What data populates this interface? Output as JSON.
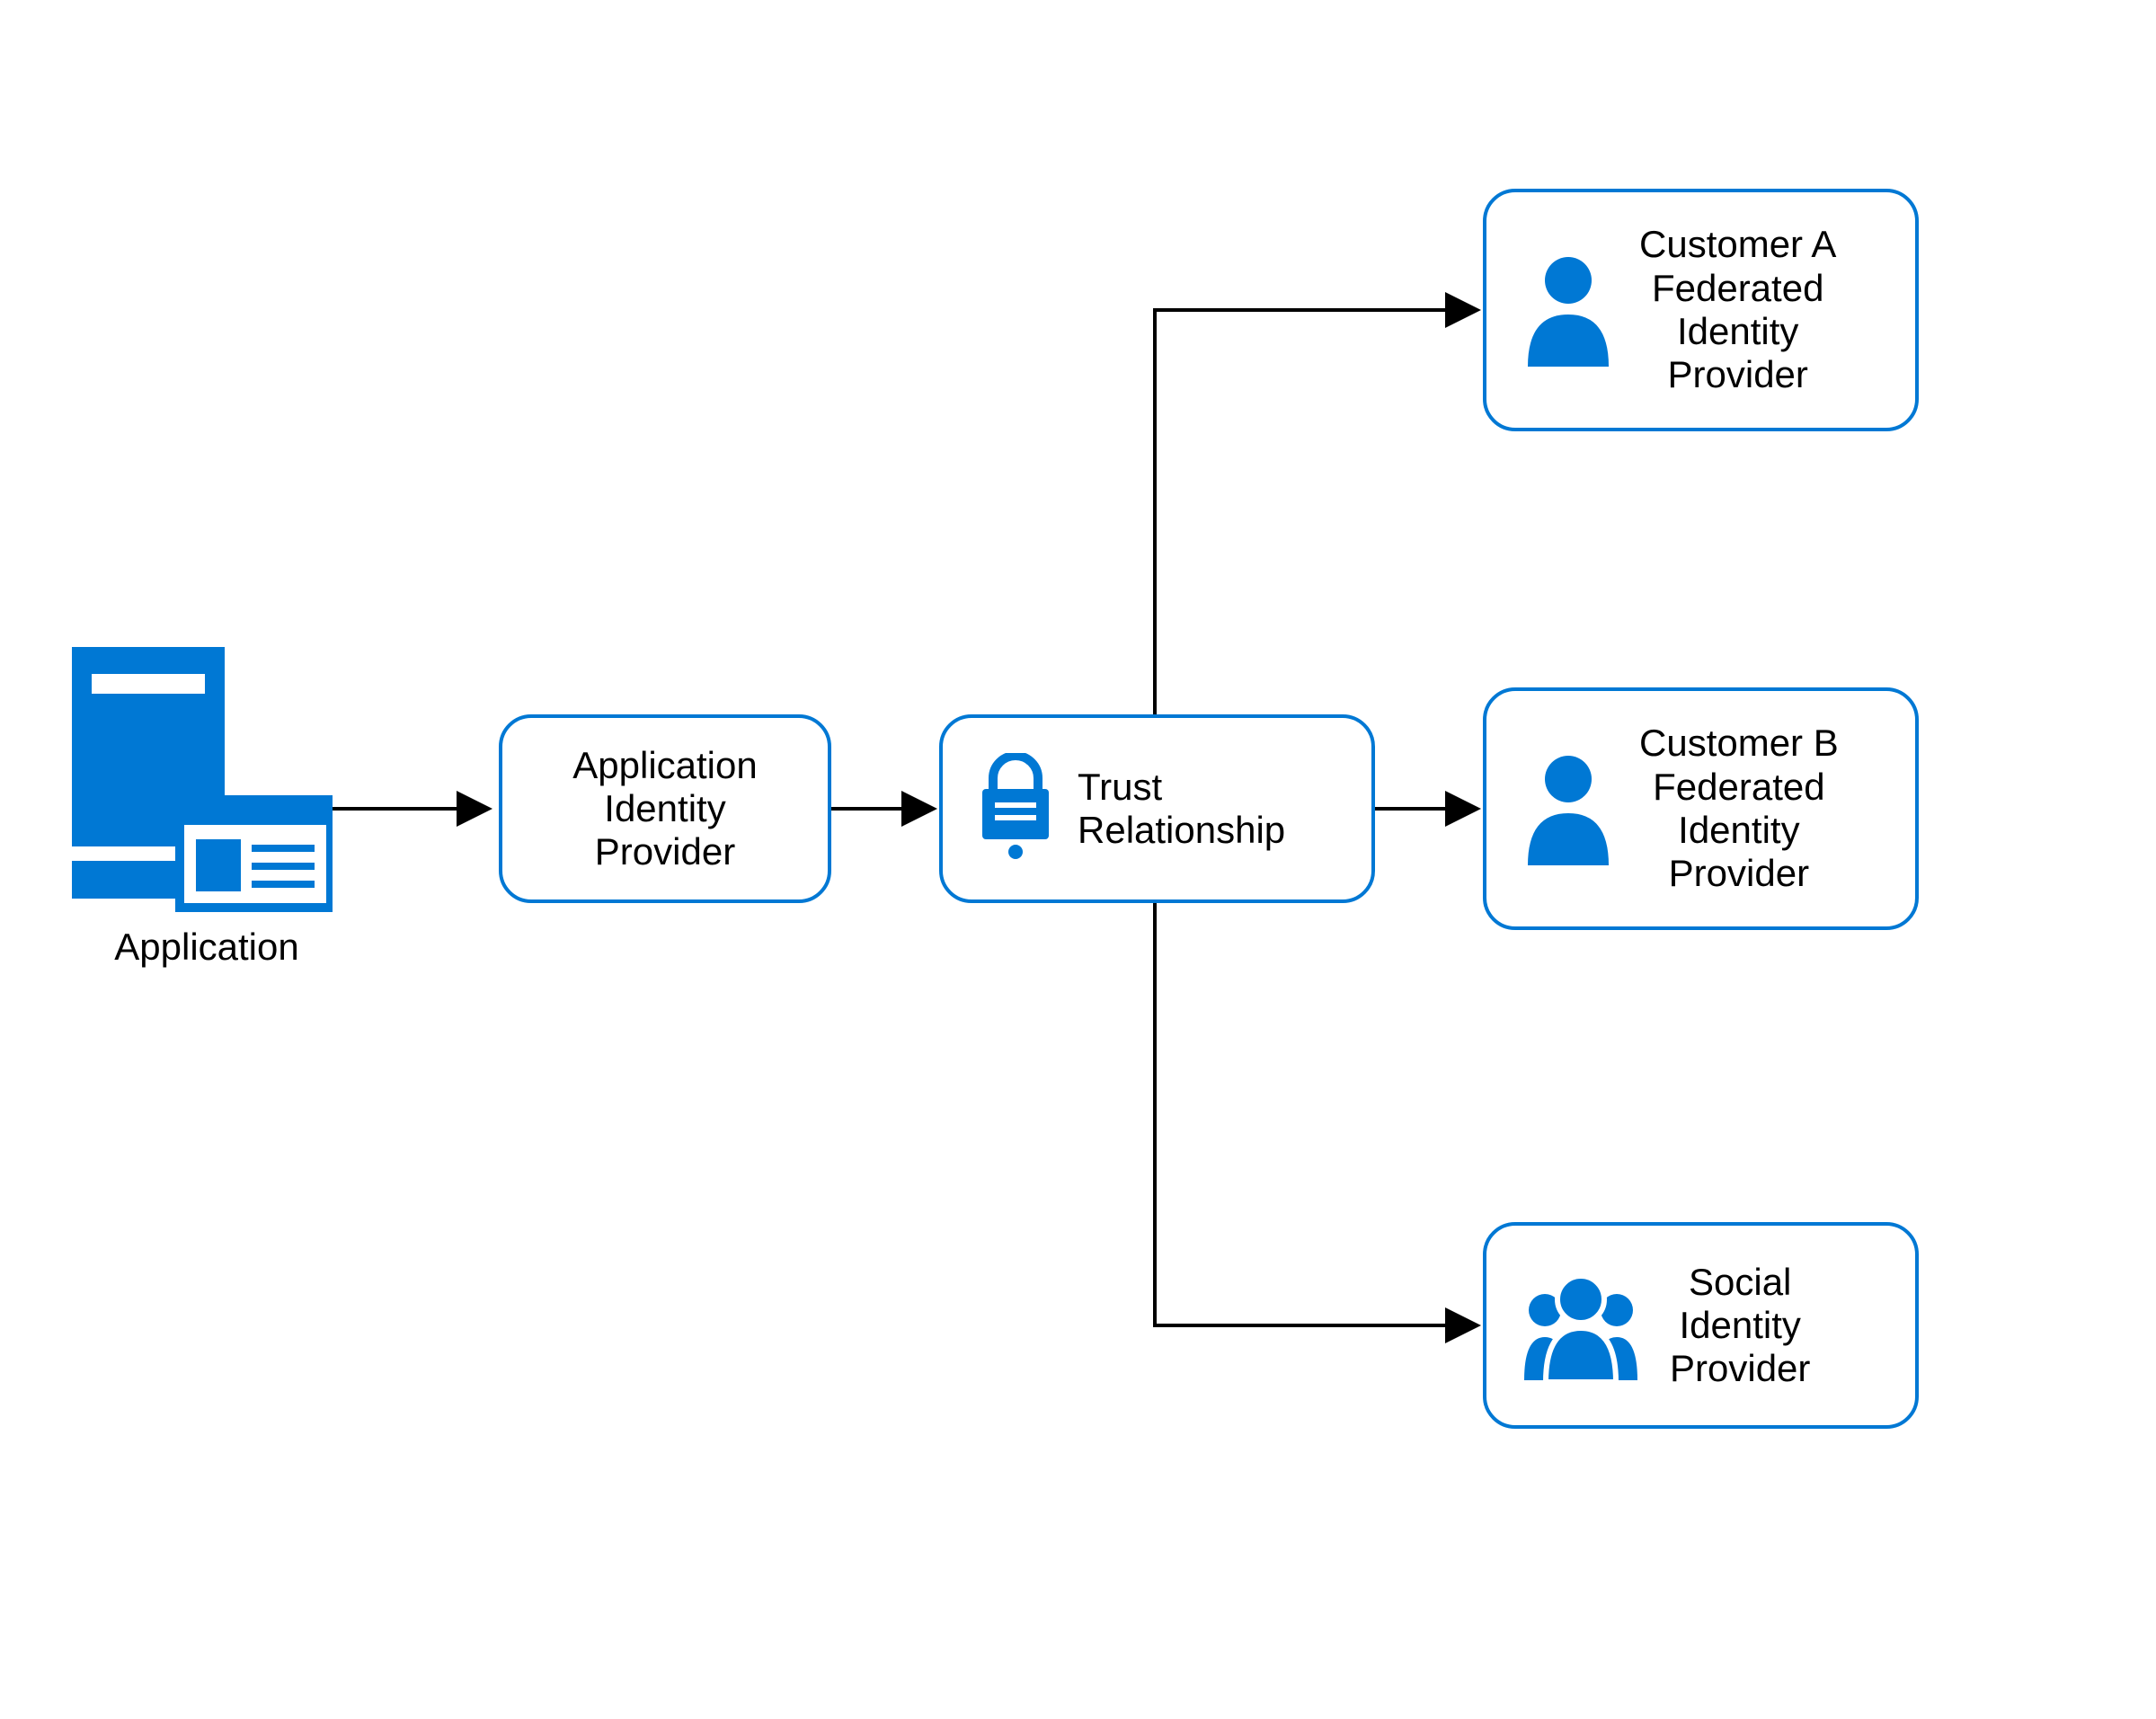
{
  "colors": {
    "accent": "#0078d4",
    "line": "#000000"
  },
  "application": {
    "label": "Application"
  },
  "nodes": {
    "app_idp": {
      "label_line1": "Application",
      "label_line2": "Identity",
      "label_line3": "Provider"
    },
    "trust": {
      "label_line1": "Trust",
      "label_line2": "Relationship"
    },
    "cust_a": {
      "line1": "Customer A",
      "line2": "Federated",
      "line3": "Identity",
      "line4": "Provider"
    },
    "cust_b": {
      "line1": "Customer B",
      "line2": "Federated",
      "line3": "Identity",
      "line4": "Provider"
    },
    "social": {
      "line1": "Social",
      "line2": "Identity",
      "line3": "Provider"
    }
  }
}
